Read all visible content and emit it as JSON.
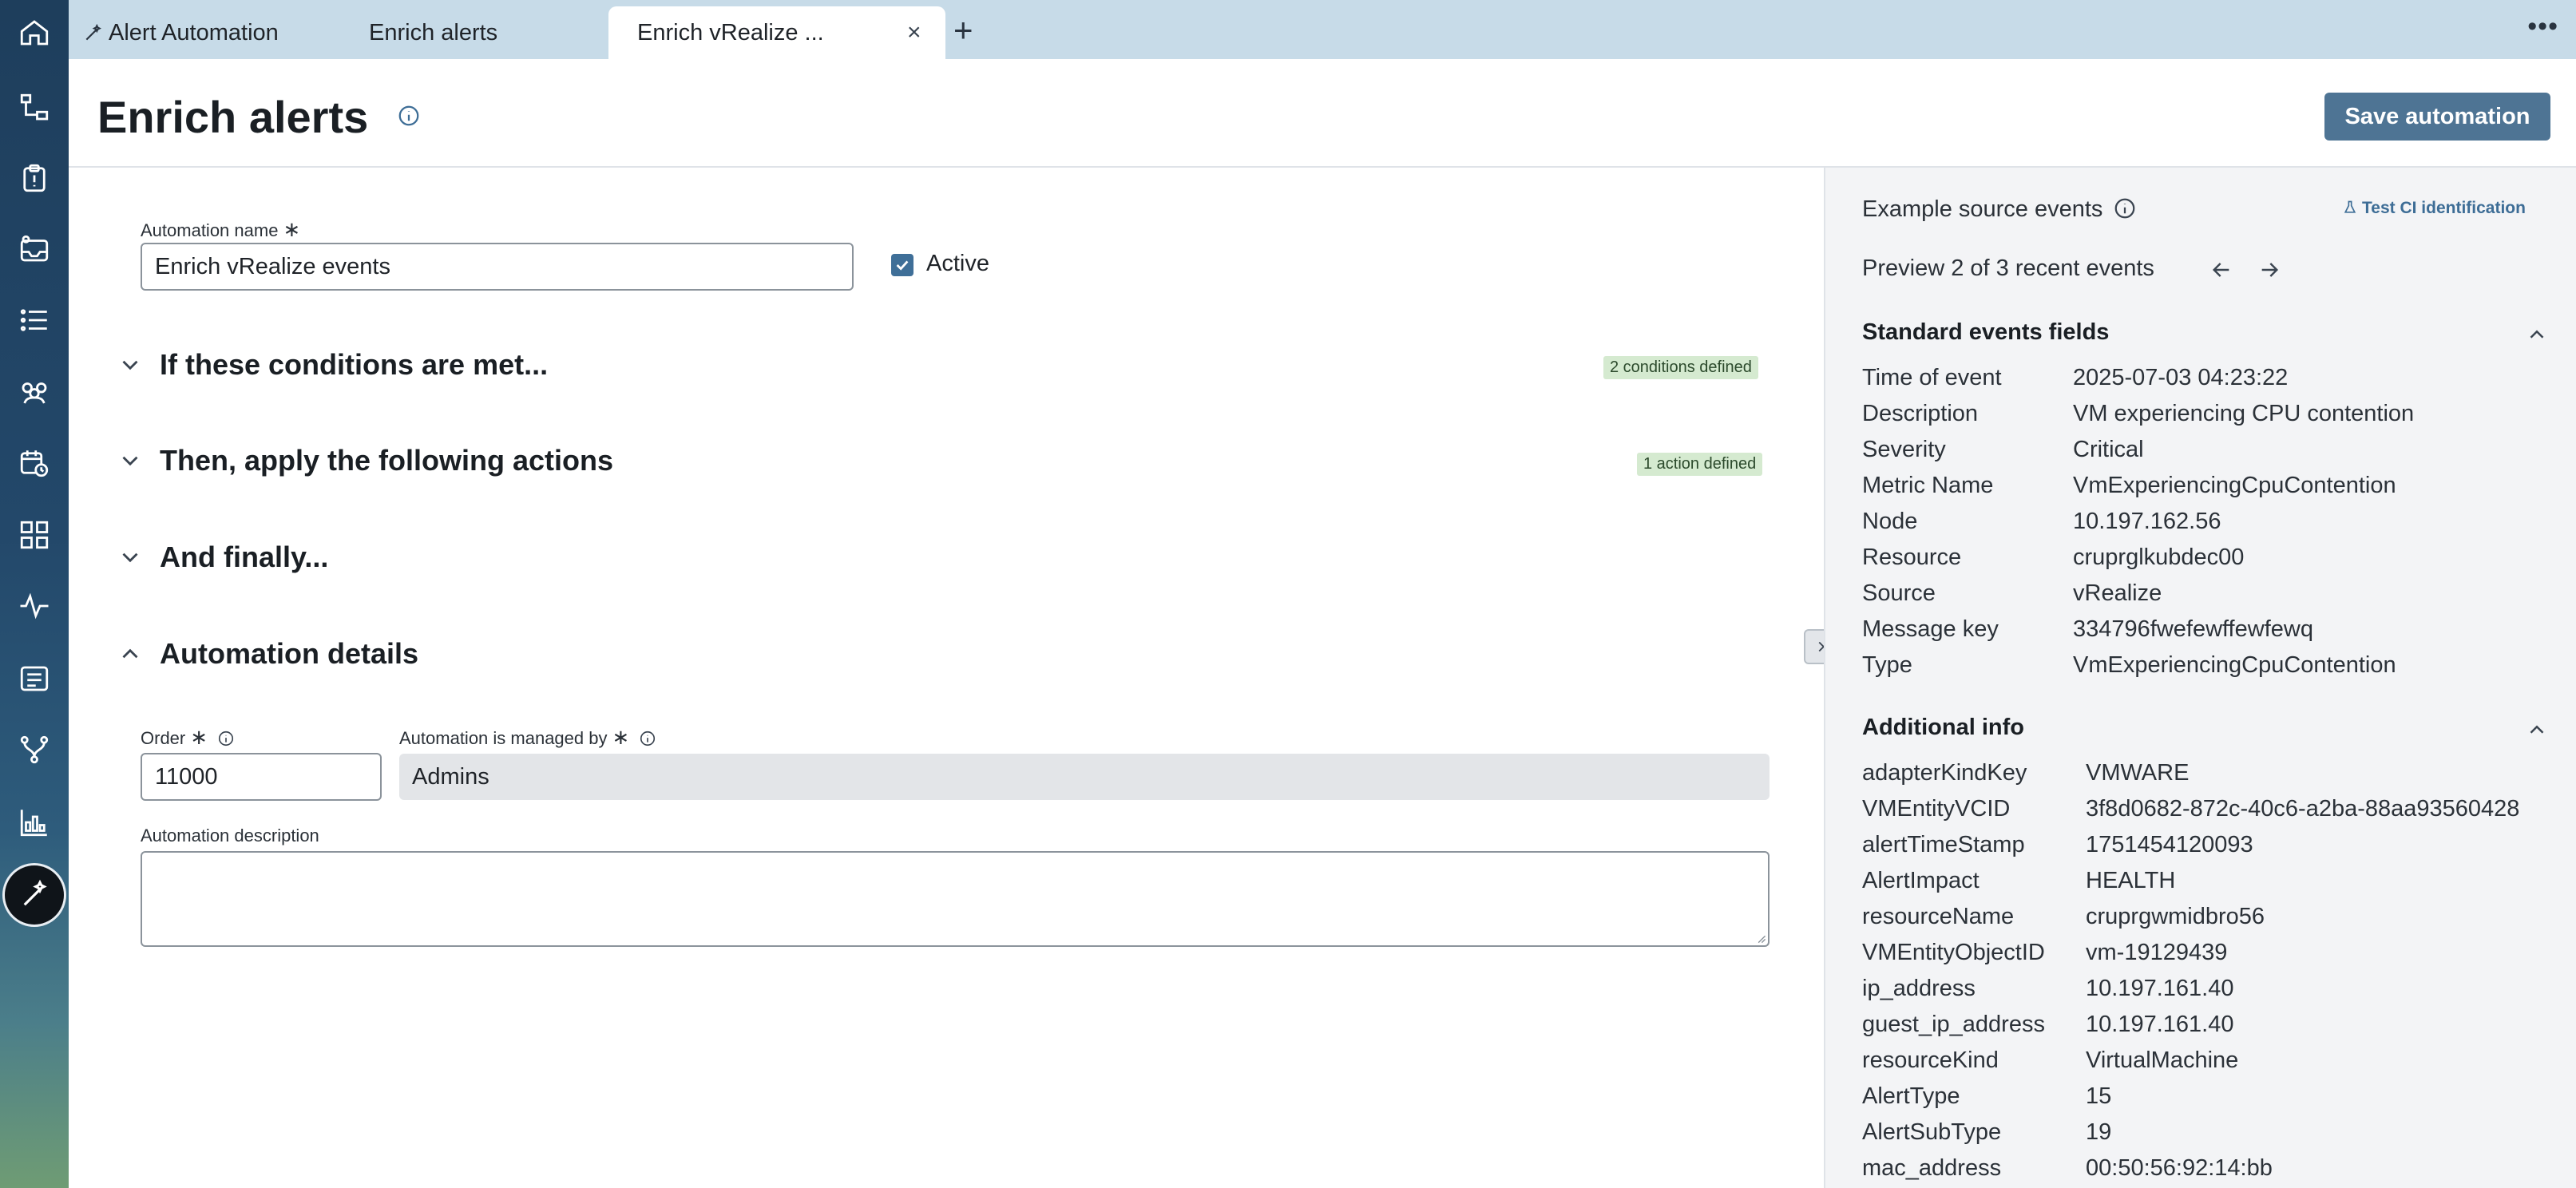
{
  "tabs": [
    {
      "label": "Alert Automation",
      "icon": "wand-icon",
      "closable": false
    },
    {
      "label": "Enrich alerts",
      "closable": true
    },
    {
      "label": "Enrich vRealize ...",
      "closable": true,
      "active": true
    }
  ],
  "tabbar": {
    "add_label": "+",
    "more_label": "•••",
    "close_label": "×"
  },
  "nav": {
    "items": [
      "home-icon",
      "hierarchy-icon",
      "clipboard-icon",
      "inbox-icon",
      "list-icon",
      "team-icon",
      "calendar-clock-icon",
      "dashboard-grid-icon",
      "pulse-icon",
      "log-list-icon",
      "branch-icon",
      "bar-chart-icon",
      "magic-wand-icon"
    ],
    "active": "magic-wand-icon"
  },
  "header": {
    "title": "Enrich alerts",
    "save_label": "Save automation"
  },
  "form": {
    "name_label": "Automation name",
    "name_value": "Enrich vRealize events",
    "active_label": "Active",
    "active_checked": true,
    "sections": [
      {
        "title": "If these conditions are met...",
        "badge": "2 conditions defined",
        "expanded": false
      },
      {
        "title": "Then, apply the following actions",
        "badge": "1 action defined",
        "expanded": false
      },
      {
        "title": "And finally...",
        "badge": "",
        "expanded": false
      },
      {
        "title": "Automation details",
        "badge": "",
        "expanded": true
      }
    ],
    "order_label": "Order",
    "order_value": "11000",
    "managed_label": "Automation is managed by",
    "managed_value": "Admins",
    "description_label": "Automation description",
    "description_value": ""
  },
  "panel": {
    "title": "Example source events",
    "test_link": "Test CI identification",
    "preview_text": "Preview 2 of 3 recent events",
    "standard_title": "Standard events fields",
    "standard_fields": [
      {
        "key": "Time of event",
        "value": "2025-07-03 04:23:22"
      },
      {
        "key": "Description",
        "value": "VM experiencing CPU contention"
      },
      {
        "key": "Severity",
        "value": "Critical"
      },
      {
        "key": "Metric Name",
        "value": "VmExperiencingCpuContention"
      },
      {
        "key": "Node",
        "value": "10.197.162.56"
      },
      {
        "key": "Resource",
        "value": "cruprglkubdec00"
      },
      {
        "key": "Source",
        "value": "vRealize"
      },
      {
        "key": "Message key",
        "value": "334796fwefewffewfewq"
      },
      {
        "key": "Type",
        "value": "VmExperiencingCpuContention"
      }
    ],
    "additional_title": "Additional info",
    "additional_fields": [
      {
        "key": "adapterKindKey",
        "value": "VMWARE"
      },
      {
        "key": "VMEntityVCID",
        "value": "3f8d0682-872c-40c6-a2ba-88aa93560428"
      },
      {
        "key": "alertTimeStamp",
        "value": "1751454120093"
      },
      {
        "key": "AlertImpact",
        "value": "HEALTH"
      },
      {
        "key": "resourceName",
        "value": "cruprgwmidbro56"
      },
      {
        "key": "VMEntityObjectID",
        "value": "vm-19129439"
      },
      {
        "key": "ip_address",
        "value": "10.197.161.40"
      },
      {
        "key": "guest_ip_address",
        "value": "10.197.161.40"
      },
      {
        "key": "resourceKind",
        "value": "VirtualMachine"
      },
      {
        "key": "AlertType",
        "value": "15"
      },
      {
        "key": "AlertSubType",
        "value": "19"
      },
      {
        "key": "mac_address",
        "value": "00:50:56:92:14:bb"
      }
    ]
  },
  "colors": {
    "accent": "#4e7494",
    "tabbar": "#c7dbe8",
    "badge_bg": "#d5ead0",
    "panel_bg": "#f3f4f6",
    "link": "#3d6d96"
  }
}
